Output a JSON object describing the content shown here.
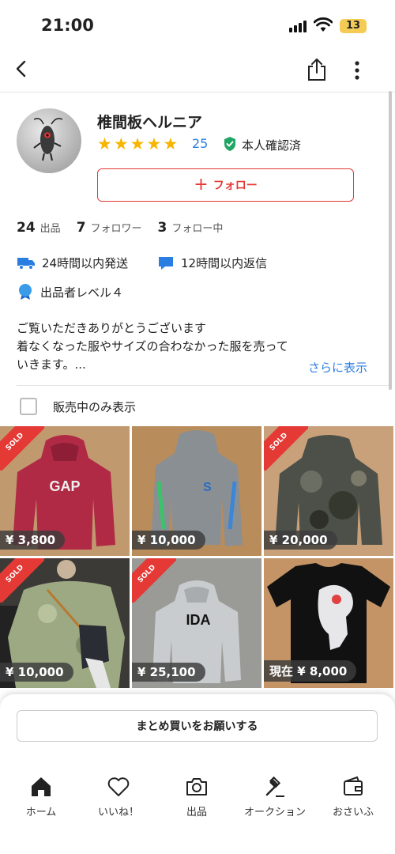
{
  "status_bar": {
    "time": "21:00",
    "battery": "13"
  },
  "seller": {
    "name": "椎間板ヘルニア",
    "rating_stars": 5,
    "review_count": "25",
    "verified_label": "本人確認済",
    "follow_label": "フォロー"
  },
  "stats": [
    {
      "value": "24",
      "label": "出品"
    },
    {
      "value": "7",
      "label": "フォロワー"
    },
    {
      "value": "3",
      "label": "フォロー中"
    }
  ],
  "features": {
    "shipping": "24時間以内発送",
    "reply": "12時間以内返信",
    "level": "出品者レベル４"
  },
  "bio": {
    "line1": "ご覧いただきありがとうございます",
    "line2": "着なくなった服やサイズの合わなかった服を売って",
    "line3": "いきます。...",
    "more_label": "さらに表示"
  },
  "filter": {
    "label": "販売中のみ表示",
    "checked": false
  },
  "items": [
    {
      "price": "¥ 3,800",
      "sold": true,
      "sold_label": "SOLD"
    },
    {
      "price": "¥ 10,000",
      "sold": false
    },
    {
      "price": "¥ 20,000",
      "sold": true,
      "sold_label": "SOLD"
    },
    {
      "price": "¥ 10,000",
      "sold": true,
      "sold_label": "SOLD"
    },
    {
      "price": "¥ 25,100",
      "sold": true,
      "sold_label": "SOLD"
    },
    {
      "price": "現在 ¥ 8,000",
      "sold": false
    }
  ],
  "bulk_button": "まとめ買いをお願いする",
  "tabs": [
    {
      "label": "ホーム",
      "icon": "home-icon"
    },
    {
      "label": "いいね！",
      "icon": "heart-icon"
    },
    {
      "label": "出品",
      "icon": "camera-icon"
    },
    {
      "label": "オークション",
      "icon": "gavel-icon"
    },
    {
      "label": "おさいふ",
      "icon": "wallet-icon"
    }
  ],
  "colors": {
    "accent_red": "#e53935",
    "link_blue": "#2a7de1",
    "star_yellow": "#f7b500",
    "verified_green": "#1fa564"
  }
}
